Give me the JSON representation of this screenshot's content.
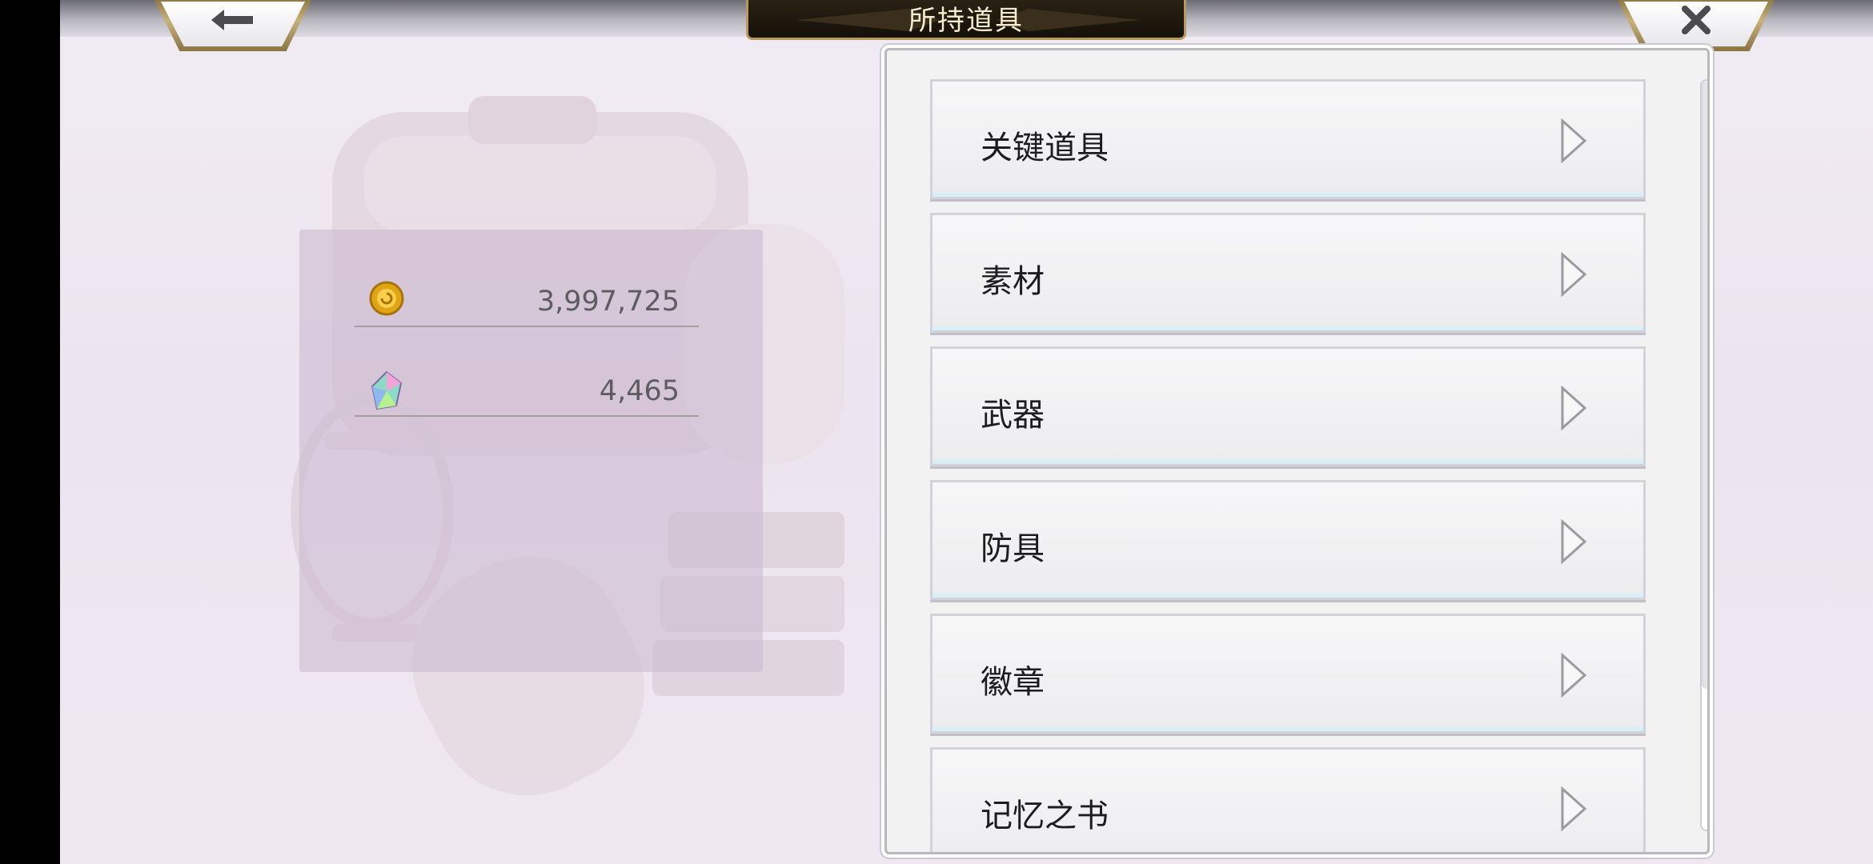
{
  "header": {
    "title": "所持道具",
    "back_icon": "arrow-left-icon",
    "close_icon": "close-icon"
  },
  "currency": [
    {
      "icon": "gold-coin-icon",
      "value": "3,997,725"
    },
    {
      "icon": "rainbow-crystal-icon",
      "value": "4,465"
    }
  ],
  "categories": [
    {
      "label": "关键道具"
    },
    {
      "label": "素材"
    },
    {
      "label": "武器"
    },
    {
      "label": "防具"
    },
    {
      "label": "徽章"
    },
    {
      "label": "记忆之书"
    }
  ],
  "colors": {
    "gold_trim": "#c8b27c",
    "title_plate": "#1f1910",
    "panel": "#cdbcd2"
  }
}
